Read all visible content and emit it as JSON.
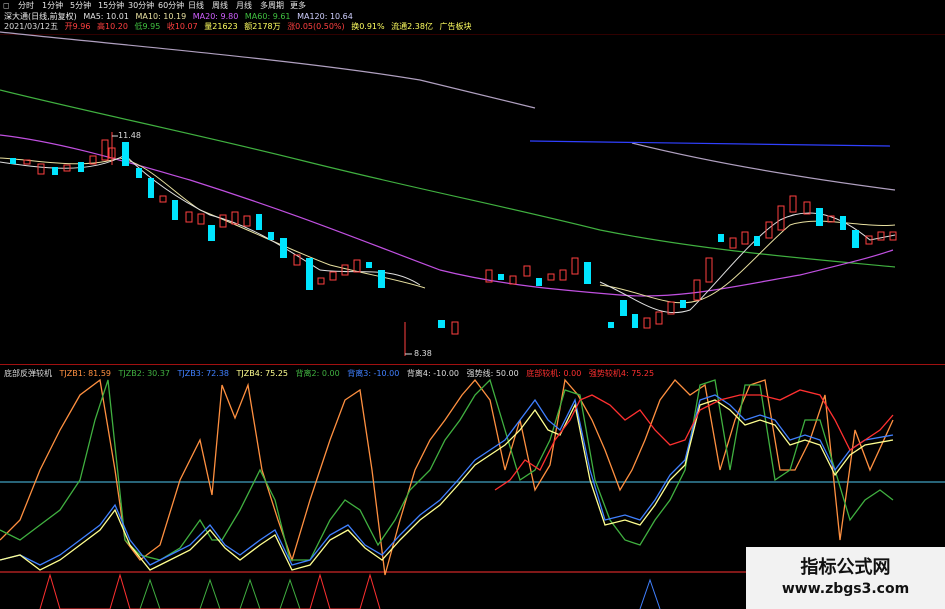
{
  "toolbar": {
    "items": [
      "分时",
      "1分钟",
      "5分钟",
      "15分钟",
      "30分钟",
      "60分钟",
      "日线",
      "周线",
      "月线",
      "多周期",
      "更多"
    ]
  },
  "stock": {
    "name": "深大通",
    "mode": "(日线,前复权)",
    "ma5": "MA5: 10.01",
    "ma10": "MA10: 10.19",
    "ma20": "MA20: 9.80",
    "ma60": "MA60: 9.61",
    "ma120": "MA120: 10.64",
    "date": "2021/03/12五",
    "open": "开9.96",
    "high": "高10.20",
    "low": "低9.95",
    "close": "收10.07",
    "volume": "量21623",
    "amount": "额2178万",
    "rise": "涨0.05(0.50%)",
    "turnover": "换0.91%",
    "float": "流通2.38亿",
    "ad": "广告板块"
  },
  "price_marks": {
    "high": "11.48",
    "low": "8.38"
  },
  "indicator": {
    "name": "底部反弹较机",
    "tjzb1": "TJZB1: 81.59",
    "tjzb2": "TJZB2: 30.37",
    "tjzb3": "TJZB3: 72.38",
    "tjzb4": "TJZB4: 75.25",
    "bei2": "背离2: 0.00",
    "bei3": "背离3: -10.00",
    "bei4": "背离4: -10.00",
    "strong": "强势线: 50.00",
    "buy": "底部较机: 0.00",
    "strong4": "强势较机4: 75.25"
  },
  "colors": {
    "bg": "#000000",
    "up": "#ff4040",
    "down": "#00e5ff",
    "ma5": "#e0e0e0",
    "ma10": "#e8e0a0",
    "ma20": "#d060ff",
    "ma60": "#40c040",
    "ma120": "#b0a0d0",
    "orange": "#ff9040",
    "yellow": "#ffff90",
    "blue": "#4080ff",
    "green": "#40c040",
    "red": "#ff3030",
    "cyan": "#40c0d0"
  },
  "watermark": {
    "line1": "指标公式网",
    "line2": "www.zbgs3.com"
  }
}
